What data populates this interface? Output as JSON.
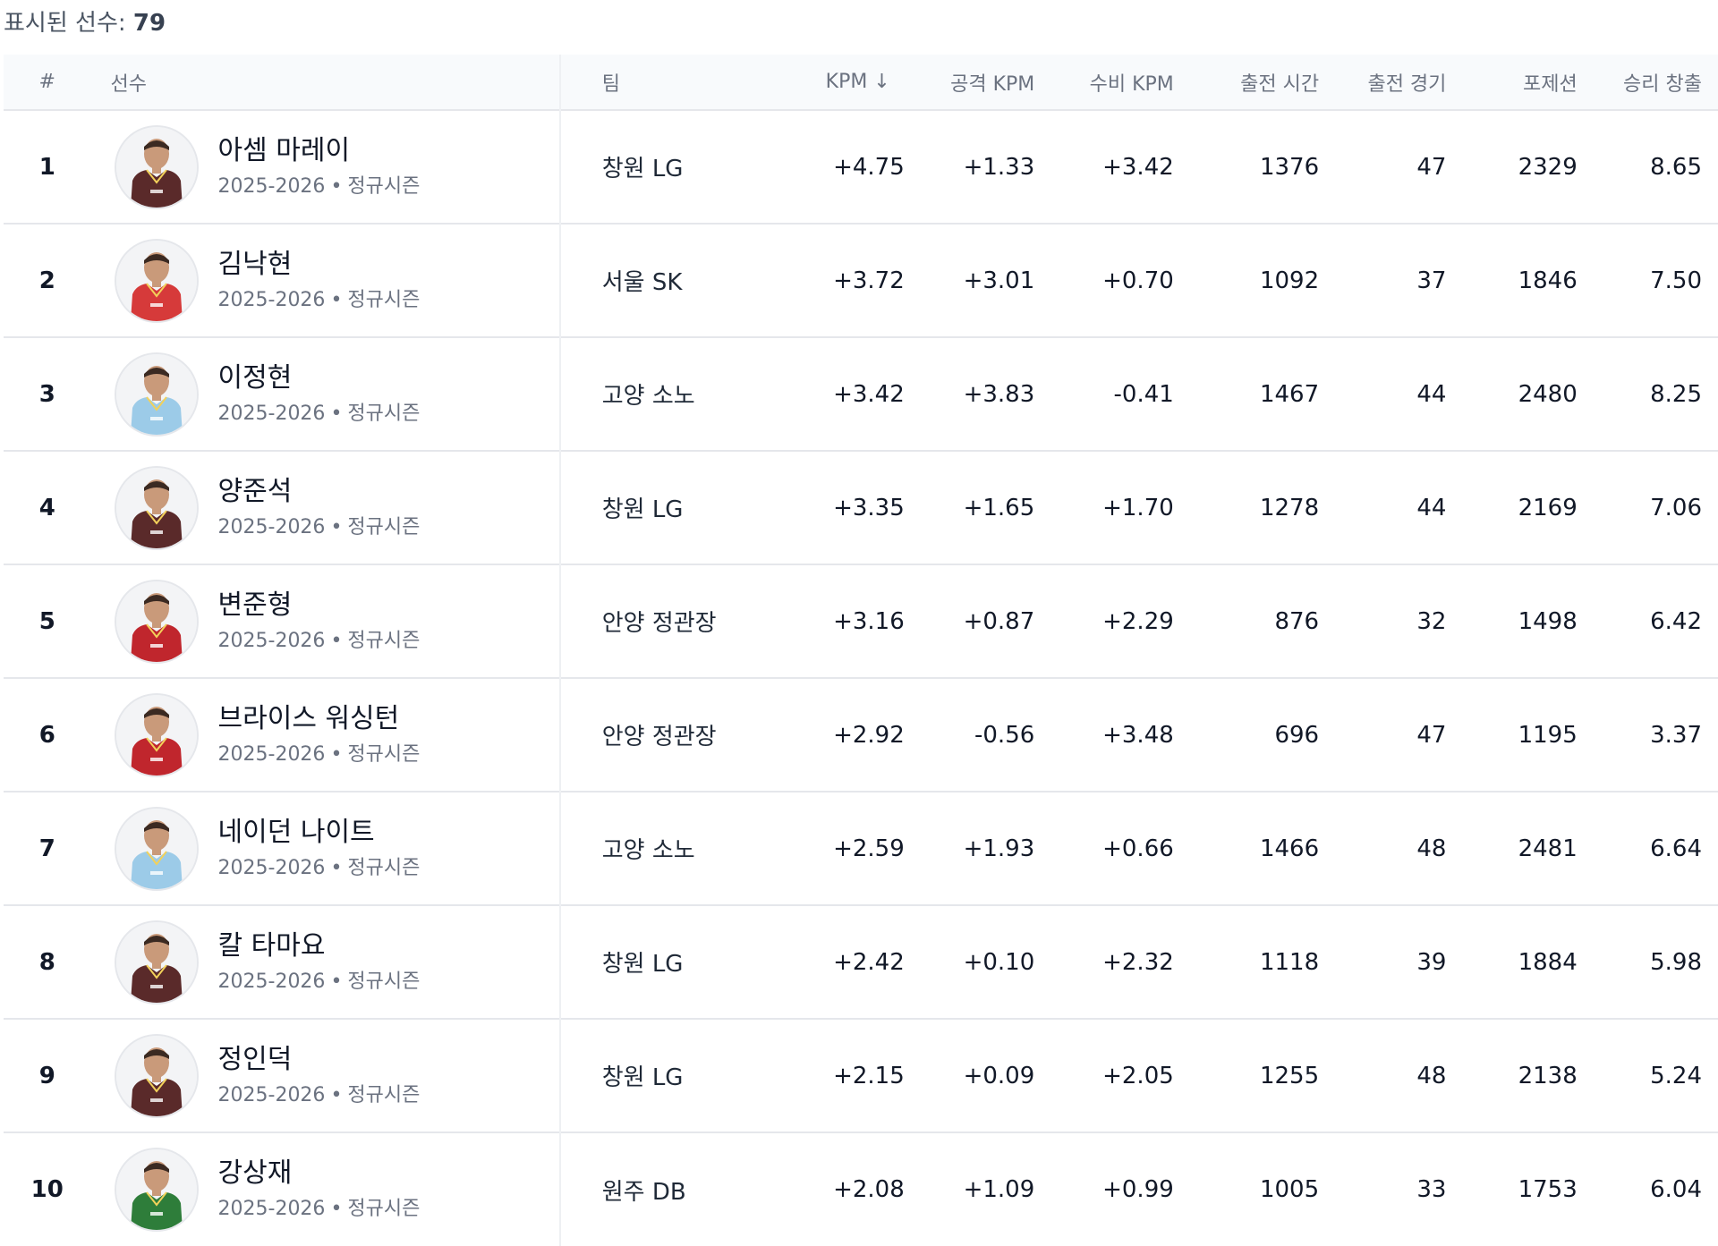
{
  "summary": {
    "label": "표시된 선수:",
    "count": "79"
  },
  "columns": {
    "rank": "#",
    "player": "선수",
    "team": "팀",
    "kpm": "KPM ↓",
    "off_kpm": "공격 KPM",
    "def_kpm": "수비 KPM",
    "minutes": "출전 시간",
    "games": "출전 경기",
    "possessions": "포제션",
    "wins_created": "승리 창출"
  },
  "players": [
    {
      "rank": "1",
      "name": "아셈 마레이",
      "season": "2025-2026",
      "season_type": "정규시즌",
      "team": "창원 LG",
      "kpm": "+4.75",
      "off_kpm": "+1.33",
      "def_kpm": "+3.42",
      "minutes": "1376",
      "games": "47",
      "possessions": "2329",
      "wins_created": "8.65",
      "jersey_color": "#5a2a2a"
    },
    {
      "rank": "2",
      "name": "김낙현",
      "season": "2025-2026",
      "season_type": "정규시즌",
      "team": "서울 SK",
      "kpm": "+3.72",
      "off_kpm": "+3.01",
      "def_kpm": "+0.70",
      "minutes": "1092",
      "games": "37",
      "possessions": "1846",
      "wins_created": "7.50",
      "jersey_color": "#d63a3a"
    },
    {
      "rank": "3",
      "name": "이정현",
      "season": "2025-2026",
      "season_type": "정규시즌",
      "team": "고양 소노",
      "kpm": "+3.42",
      "off_kpm": "+3.83",
      "def_kpm": "-0.41",
      "minutes": "1467",
      "games": "44",
      "possessions": "2480",
      "wins_created": "8.25",
      "jersey_color": "#9ccbe8"
    },
    {
      "rank": "4",
      "name": "양준석",
      "season": "2025-2026",
      "season_type": "정규시즌",
      "team": "창원 LG",
      "kpm": "+3.35",
      "off_kpm": "+1.65",
      "def_kpm": "+1.70",
      "minutes": "1278",
      "games": "44",
      "possessions": "2169",
      "wins_created": "7.06",
      "jersey_color": "#5a2a2a"
    },
    {
      "rank": "5",
      "name": "변준형",
      "season": "2025-2026",
      "season_type": "정규시즌",
      "team": "안양 정관장",
      "kpm": "+3.16",
      "off_kpm": "+0.87",
      "def_kpm": "+2.29",
      "minutes": "876",
      "games": "32",
      "possessions": "1498",
      "wins_created": "6.42",
      "jersey_color": "#c0262d"
    },
    {
      "rank": "6",
      "name": "브라이스 워싱턴",
      "season": "2025-2026",
      "season_type": "정규시즌",
      "team": "안양 정관장",
      "kpm": "+2.92",
      "off_kpm": "-0.56",
      "def_kpm": "+3.48",
      "minutes": "696",
      "games": "47",
      "possessions": "1195",
      "wins_created": "3.37",
      "jersey_color": "#c0262d"
    },
    {
      "rank": "7",
      "name": "네이던 나이트",
      "season": "2025-2026",
      "season_type": "정규시즌",
      "team": "고양 소노",
      "kpm": "+2.59",
      "off_kpm": "+1.93",
      "def_kpm": "+0.66",
      "minutes": "1466",
      "games": "48",
      "possessions": "2481",
      "wins_created": "6.64",
      "jersey_color": "#9ccbe8"
    },
    {
      "rank": "8",
      "name": "칼 타마요",
      "season": "2025-2026",
      "season_type": "정규시즌",
      "team": "창원 LG",
      "kpm": "+2.42",
      "off_kpm": "+0.10",
      "def_kpm": "+2.32",
      "minutes": "1118",
      "games": "39",
      "possessions": "1884",
      "wins_created": "5.98",
      "jersey_color": "#5a2a2a"
    },
    {
      "rank": "9",
      "name": "정인덕",
      "season": "2025-2026",
      "season_type": "정규시즌",
      "team": "창원 LG",
      "kpm": "+2.15",
      "off_kpm": "+0.09",
      "def_kpm": "+2.05",
      "minutes": "1255",
      "games": "48",
      "possessions": "2138",
      "wins_created": "5.24",
      "jersey_color": "#5a2a2a"
    },
    {
      "rank": "10",
      "name": "강상재",
      "season": "2025-2026",
      "season_type": "정규시즌",
      "team": "원주 DB",
      "kpm": "+2.08",
      "off_kpm": "+1.09",
      "def_kpm": "+0.99",
      "minutes": "1005",
      "games": "33",
      "possessions": "1753",
      "wins_created": "6.04",
      "jersey_color": "#2e7d3a"
    }
  ]
}
